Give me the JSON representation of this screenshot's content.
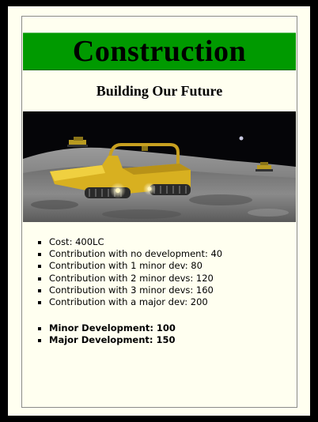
{
  "card": {
    "title": "Construction",
    "subtitle": "Building Our Future",
    "image": "lunar-construction-vehicle-image",
    "title_bg_color": "#009a00",
    "stats": [
      "Cost: 400LC",
      "Contribution with no development: 40",
      "Contribution with 1 minor dev: 80",
      "Contribution with 2 minor devs: 120",
      "Contribution with 3 minor devs: 160",
      "Contribution with a major dev: 200"
    ],
    "developments": [
      "Minor Development: 100",
      "Major Development: 150"
    ]
  }
}
